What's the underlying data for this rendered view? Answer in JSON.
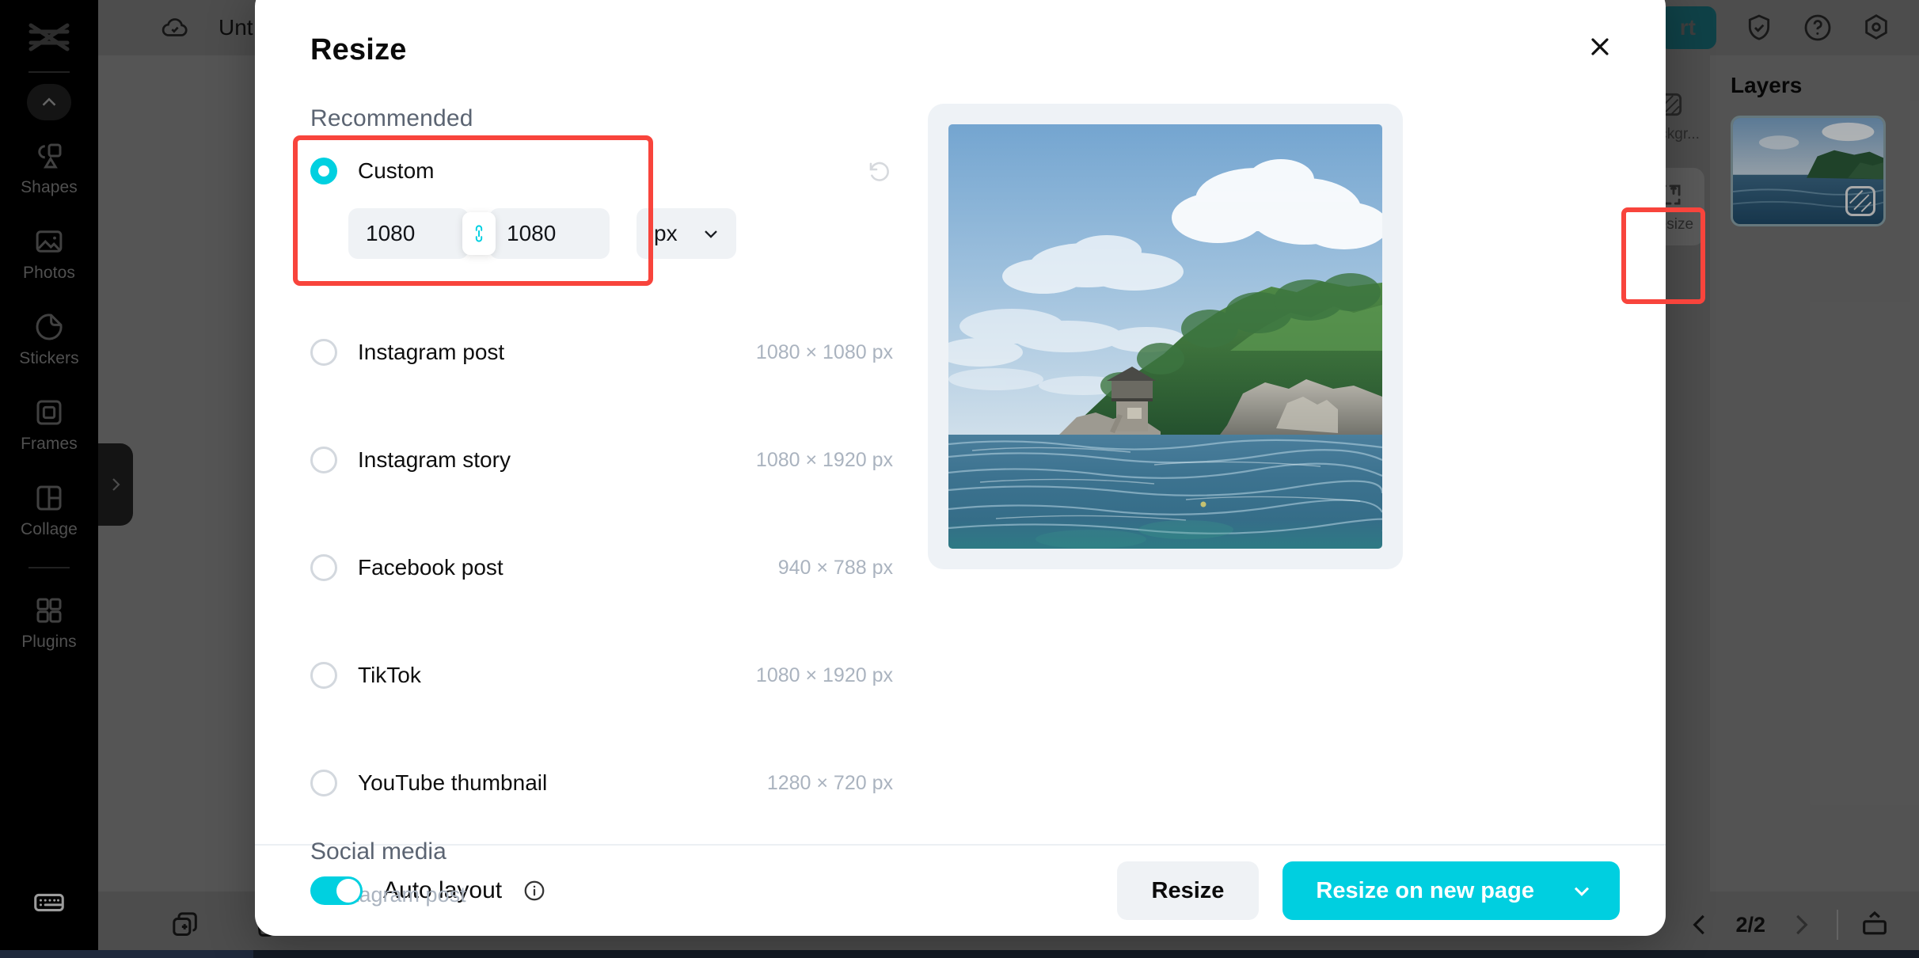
{
  "app": {
    "document_title": "Unt",
    "export_button": "rt",
    "cloud_icon": "cloud-check-icon",
    "shield_icon": "shield-check-icon",
    "help_icon": "help-circle-icon",
    "settings_icon": "settings-hexagon-icon"
  },
  "left_rail": {
    "logo_icon": "capcut-logo-icon",
    "collapse_icon": "chevron-up-icon",
    "keyboard_icon": "keyboard-icon",
    "items": [
      {
        "label": "Shapes",
        "icon": "shapes-icon"
      },
      {
        "label": "Photos",
        "icon": "photos-icon"
      },
      {
        "label": "Stickers",
        "icon": "stickers-icon"
      },
      {
        "label": "Frames",
        "icon": "frames-icon"
      },
      {
        "label": "Collage",
        "icon": "collage-icon"
      },
      {
        "label": "Plugins",
        "icon": "plugins-grid-icon"
      }
    ]
  },
  "right_tools": {
    "items": [
      {
        "label": "Backgr...",
        "icon": "background-swatch-icon",
        "active": false
      },
      {
        "label": "Resize",
        "icon": "resize-arrows-icon",
        "active": true
      }
    ]
  },
  "layers": {
    "title": "Layers",
    "thumbnail_name": "island-photo-thumbnail"
  },
  "bottom_bar": {
    "duplicate_icon": "duplicate-page-icon",
    "delete_icon": "trash-icon",
    "prev_icon": "chevron-left-icon",
    "next_icon": "chevron-right-icon",
    "page_indicator": "2/2",
    "present_icon": "present-icon"
  },
  "modal": {
    "title": "Resize",
    "close_icon": "close-x-icon",
    "recommended_heading": "Recommended",
    "custom": {
      "label": "Custom",
      "selected": true,
      "reset_icon": "reset-rotate-icon",
      "width_value": "1080",
      "height_value": "1080",
      "link_icon": "link-chain-icon",
      "unit_value": "px",
      "unit_chevron_icon": "chevron-down-icon"
    },
    "presets": [
      {
        "label": "Instagram post",
        "dimensions": "1080 × 1080 px",
        "selected": false
      },
      {
        "label": "Instagram story",
        "dimensions": "1080 × 1920 px",
        "selected": false
      },
      {
        "label": "Facebook post",
        "dimensions": "940 × 788 px",
        "selected": false
      },
      {
        "label": "TikTok",
        "dimensions": "1080 × 1920 px",
        "selected": false
      },
      {
        "label": "YouTube thumbnail",
        "dimensions": "1280 × 720 px",
        "selected": false
      }
    ],
    "social_media": {
      "heading": "Social media",
      "items": [
        {
          "label": "Instagram post"
        }
      ]
    },
    "preview_image_name": "island-seascape-preview",
    "footer": {
      "auto_layout_label": "Auto layout",
      "auto_layout_on": true,
      "info_icon": "info-circle-icon",
      "resize_button": "Resize",
      "resize_new_page_button": "Resize on new page",
      "resize_new_page_chevron_icon": "chevron-down-icon"
    }
  },
  "annotations": {
    "highlight_color": "#f8443c",
    "accent_color": "#00cfe0",
    "boxes": [
      {
        "name": "custom-size-highlight"
      },
      {
        "name": "resize-tool-highlight"
      }
    ]
  }
}
